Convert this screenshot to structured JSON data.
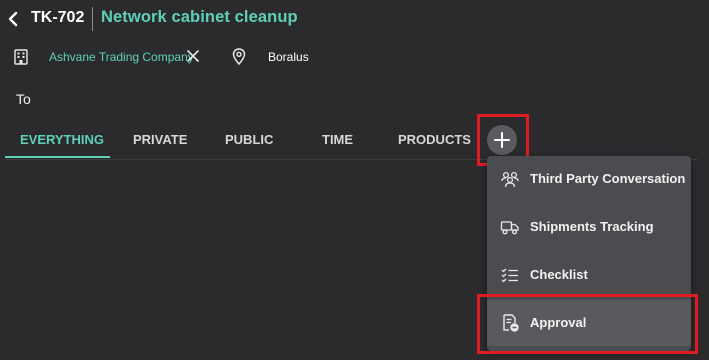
{
  "header": {
    "ticket_id": "TK-702",
    "title": "Network cabinet cleanup",
    "back_icon": "chevron-left-icon"
  },
  "info": {
    "company": "Ashvane Trading Company",
    "location": "Boralus"
  },
  "to_label": "To",
  "tabs": [
    {
      "label": "EVERYTHING",
      "active": true
    },
    {
      "label": "PRIVATE",
      "active": false
    },
    {
      "label": "PUBLIC",
      "active": false
    },
    {
      "label": "TIME",
      "active": false
    },
    {
      "label": "PRODUCTS",
      "active": false
    }
  ],
  "add_menu": {
    "items": [
      {
        "label": "Third Party Conversation",
        "icon": "people-group-icon"
      },
      {
        "label": "Shipments Tracking",
        "icon": "truck-icon"
      },
      {
        "label": "Checklist",
        "icon": "checklist-icon"
      },
      {
        "label": "Approval",
        "icon": "approval-document-icon"
      }
    ]
  },
  "colors": {
    "accent": "#5fd0b7",
    "background": "#2b2b2e",
    "menu_bg": "#4b4c50",
    "highlight": "#e11b22"
  }
}
